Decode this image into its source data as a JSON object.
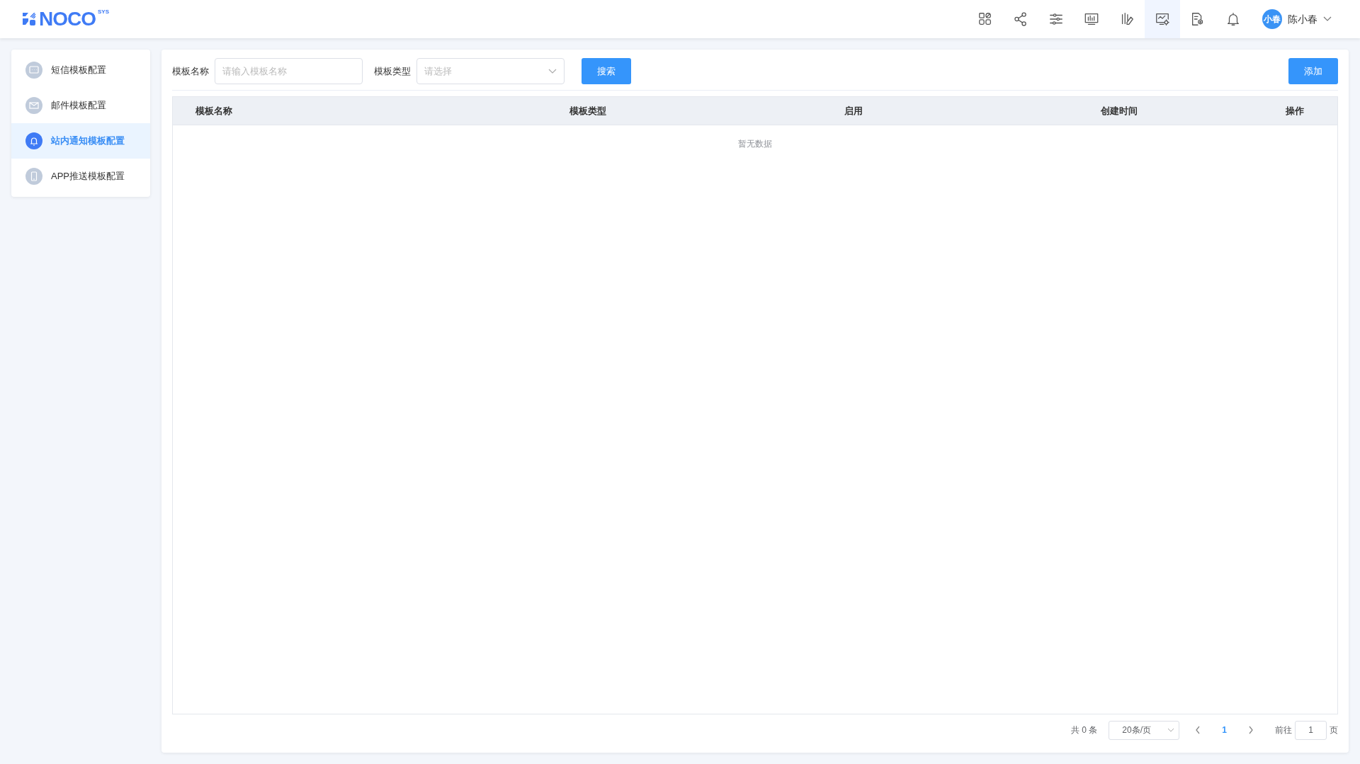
{
  "header": {
    "logo": "NOCO",
    "logo_sup": "SYS",
    "nav_icons": [
      {
        "kind": "apps",
        "selected": false
      },
      {
        "kind": "share",
        "selected": false
      },
      {
        "kind": "sliders",
        "selected": false
      },
      {
        "kind": "monitor-chart",
        "selected": false
      },
      {
        "kind": "bars-pen",
        "selected": false
      },
      {
        "kind": "monitor-gear",
        "selected": true
      },
      {
        "kind": "doc-gear",
        "selected": false
      },
      {
        "kind": "bell",
        "selected": false
      }
    ],
    "user": {
      "avatar": "小春",
      "name": "陈小春"
    }
  },
  "sidebar": {
    "items": [
      {
        "kind": "chat",
        "label": "短信模板配置",
        "selected": false
      },
      {
        "kind": "mail",
        "label": "邮件模板配置",
        "selected": false
      },
      {
        "kind": "bell",
        "label": "站内通知模板配置",
        "selected": true
      },
      {
        "kind": "phone",
        "label": "APP推送模板配置",
        "selected": false
      }
    ]
  },
  "filters": {
    "name_label": "模板名称",
    "name_placeholder": "请输入模板名称",
    "type_label": "模板类型",
    "type_placeholder": "请选择",
    "search_button": "搜索",
    "add_button": "添加"
  },
  "table": {
    "columns": [
      "模板名称",
      "模板类型",
      "启用",
      "创建时间",
      "操作"
    ],
    "empty_text": "暂无数据"
  },
  "pagination": {
    "total": "共 0 条",
    "page_size": "20条/页",
    "pages": [
      {
        "label": "1",
        "selected": true
      }
    ],
    "goto_label": "前往",
    "goto_value": "1",
    "goto_suffix": "页"
  }
}
